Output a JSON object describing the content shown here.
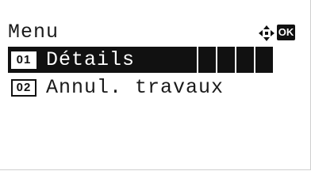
{
  "header": {
    "title": "Menu",
    "nav_icon": "four-way-arrow-icon",
    "ok_label": "OK"
  },
  "menu": {
    "items": [
      {
        "number": "01",
        "label": "Détails",
        "selected": true
      },
      {
        "number": "02",
        "label": "Annul. travaux",
        "selected": false
      }
    ]
  },
  "colors": {
    "background": "#ffffff",
    "foreground": "#111111",
    "selection": "#111111"
  }
}
